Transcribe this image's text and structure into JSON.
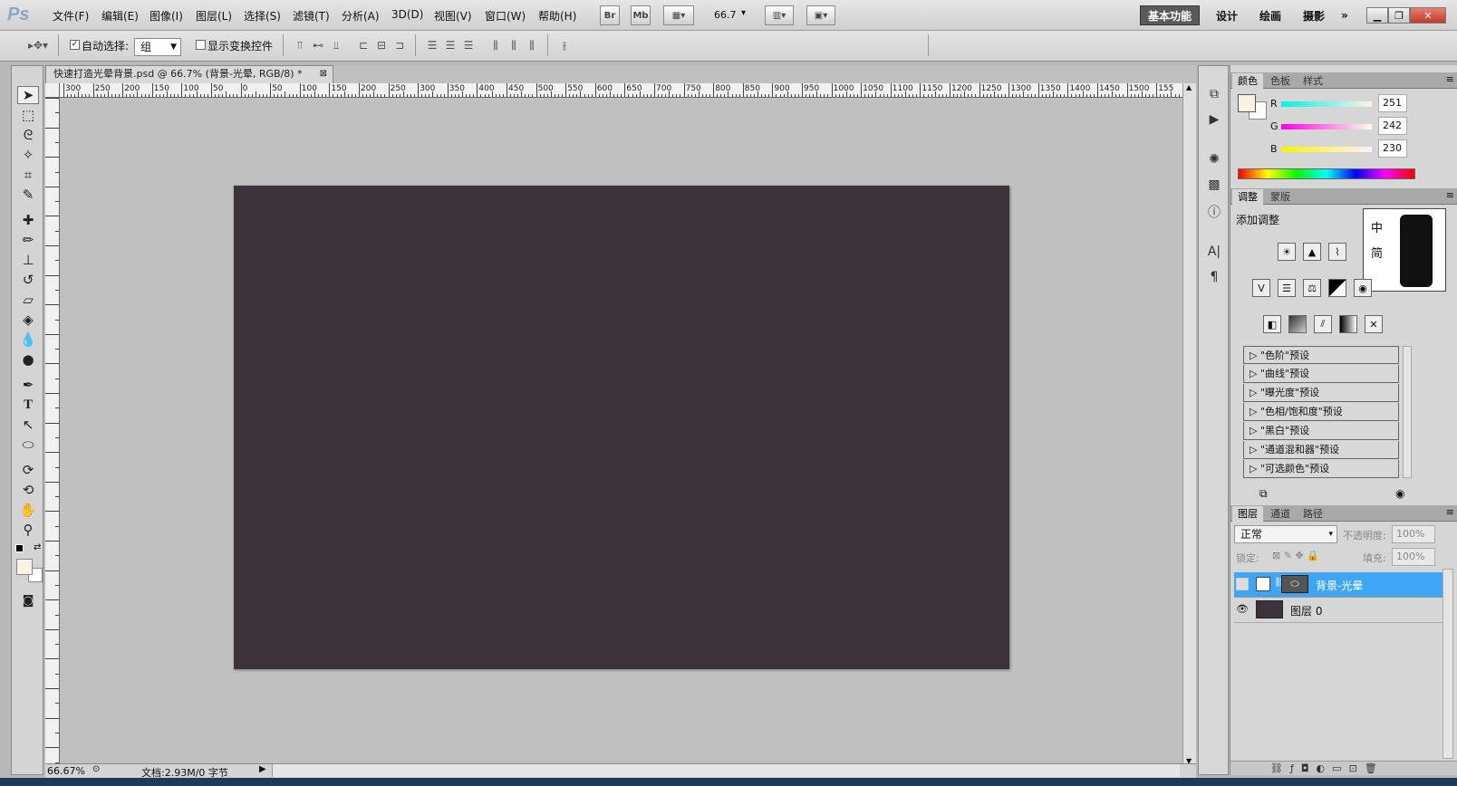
{
  "app": {
    "logo": "Ps"
  },
  "menu": [
    "文件(F)",
    "编辑(E)",
    "图像(I)",
    "图层(L)",
    "选择(S)",
    "滤镜(T)",
    "分析(A)",
    "3D(D)",
    "视图(V)",
    "窗口(W)",
    "帮助(H)"
  ],
  "menu_buttons": {
    "bridge": "Br",
    "minibridge": "Mb",
    "zoom": "66.7"
  },
  "workspaces": {
    "active": "基本功能",
    "items": [
      "设计",
      "绘画",
      "摄影"
    ],
    "more": "»"
  },
  "options": {
    "auto_select_label": "自动选择:",
    "auto_select_value": "组",
    "show_transform_label": "显示变换控件"
  },
  "document": {
    "tab_title": "快速打造光晕背景.psd @ 66.7% (背景-光晕, RGB/8) *",
    "canvas_color": "#3d333b",
    "zoom_status": "66.67%",
    "doc_info": "文档:2.93M/0 字节"
  },
  "ruler": {
    "h_labels": [
      "300",
      "250",
      "200",
      "150",
      "100",
      "50",
      "0",
      "50",
      "100",
      "150",
      "200",
      "250",
      "300",
      "350",
      "400",
      "450",
      "500",
      "550",
      "600",
      "650",
      "700",
      "750",
      "800",
      "850",
      "900",
      "950",
      "1000",
      "1050",
      "1100",
      "1150",
      "1200",
      "1250",
      "1300",
      "1350",
      "1400",
      "1450",
      "1500",
      "155"
    ]
  },
  "color_panel": {
    "tabs": [
      "颜色",
      "色板",
      "样式"
    ],
    "r_label": "R",
    "g_label": "G",
    "b_label": "B",
    "r": "251",
    "g": "242",
    "b": "230",
    "fg_color": "#fbf2e6"
  },
  "adjust_panel": {
    "tabs": [
      "调整",
      "蒙版"
    ],
    "title": "添加调整",
    "presets": [
      "\"色阶\"预设",
      "\"曲线\"预设",
      "\"曝光度\"预设",
      "\"色相/饱和度\"预设",
      "\"黑白\"预设",
      "\"通道混和器\"预设",
      "\"可选颜色\"预设"
    ],
    "ime": [
      "中",
      "简"
    ]
  },
  "layers_panel": {
    "tabs": [
      "图层",
      "通道",
      "路径"
    ],
    "blend_mode": "正常",
    "opacity_label": "不透明度:",
    "opacity": "100%",
    "lock_label": "锁定:",
    "fill_label": "填充:",
    "fill": "100%",
    "layers": [
      {
        "name": "背景-光晕",
        "selected": true,
        "visible": false
      },
      {
        "name": "图层 0",
        "selected": false,
        "visible": true
      }
    ]
  }
}
